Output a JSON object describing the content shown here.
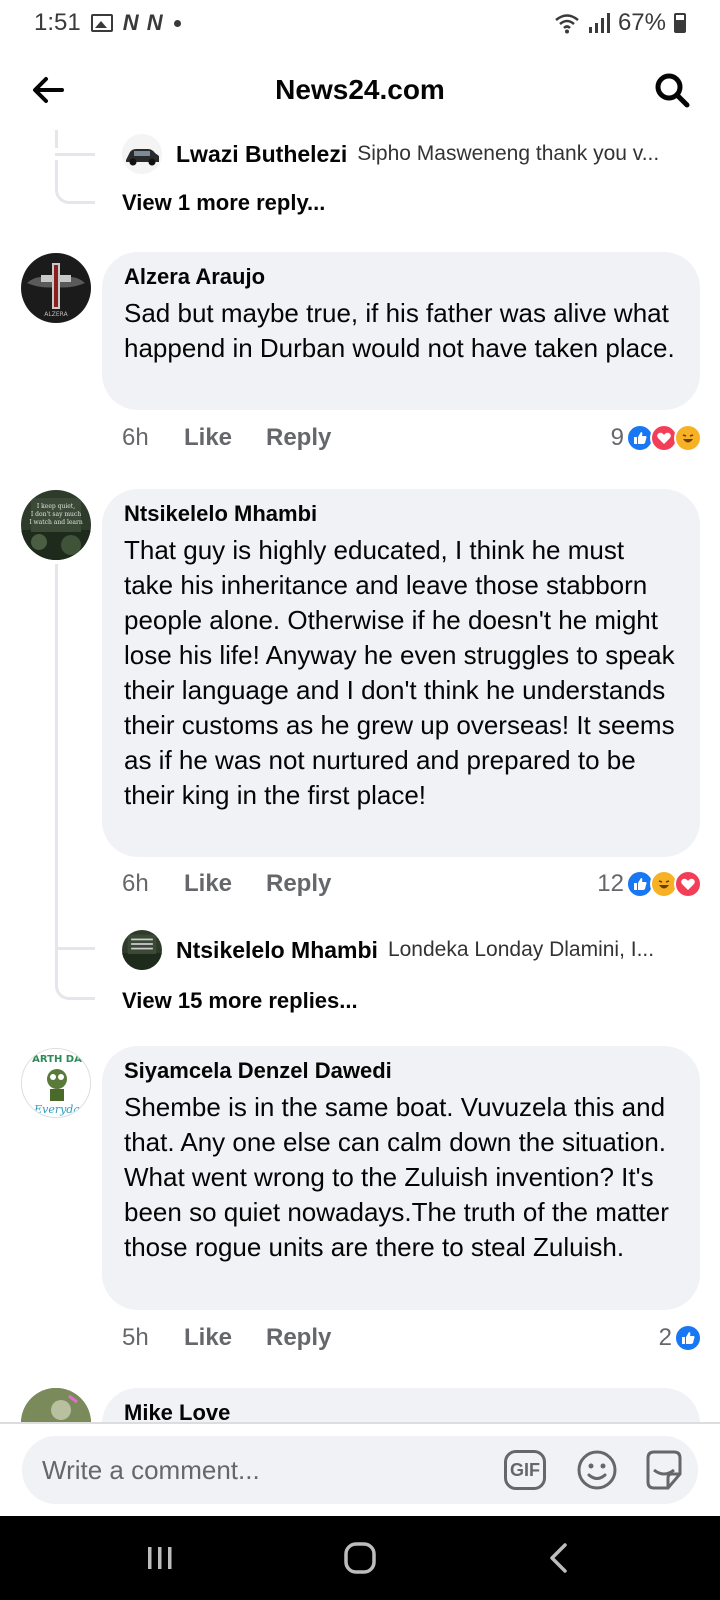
{
  "status_bar": {
    "time": "1:51",
    "notification_icons": [
      "photo-icon",
      "n-icon",
      "n-icon",
      "dot-icon"
    ],
    "battery": "67%"
  },
  "header": {
    "title": "News24.com"
  },
  "comments": [
    {
      "id": "thread-0-reply",
      "reply_preview": {
        "name": "Lwazi Buthelezi",
        "snippet": "Sipho Masweneng thank you v..."
      },
      "more_replies": "View 1 more reply..."
    },
    {
      "id": "alzera",
      "author": "Alzera Araujo",
      "text": "Sad but maybe true, if his father was alive what happend in Durban would not have taken place.",
      "time": "6h",
      "like": "Like",
      "reply": "Reply",
      "reaction_count": "9",
      "reactions": [
        "like",
        "love",
        "haha"
      ]
    },
    {
      "id": "ntsikelelo",
      "author": "Ntsikelelo Mhambi",
      "text": "That guy is highly educated, I think he must take his inheritance and leave those stabborn people alone. Otherwise if he doesn't he might lose his life! Anyway he even struggles  to speak their language and I don't think he understands their customs as he grew up overseas! It seems as if he was not nurtured and prepared to be their king in the first place!",
      "time": "6h",
      "like": "Like",
      "reply": "Reply",
      "reaction_count": "12",
      "reactions": [
        "like",
        "haha",
        "love"
      ],
      "reply_preview": {
        "name": "Ntsikelelo Mhambi",
        "snippet": "Londeka Londay Dlamini,  I..."
      },
      "more_replies": "View 15 more replies..."
    },
    {
      "id": "siyamcela",
      "author": "Siyamcela Denzel Dawedi",
      "text": "Shembe is in the same boat. Vuvuzela this and that. Any one else can calm down the situation. What went wrong to the Zuluish invention? It's been so quiet nowadays.The truth of the matter  those rogue units are there to steal Zuluish.",
      "time": "5h",
      "like": "Like",
      "reply": "Reply",
      "reaction_count": "2",
      "reactions": [
        "like"
      ]
    },
    {
      "id": "mike",
      "author": "Mike Love"
    }
  ],
  "composer": {
    "placeholder": "Write a comment...",
    "gif_label": "GIF"
  },
  "colors": {
    "like_blue": "#1877f2",
    "love_red": "#f33e58",
    "haha_yellow": "#f7b125",
    "bubble_bg": "#f0f2f5",
    "meta_gray": "#65676b"
  }
}
